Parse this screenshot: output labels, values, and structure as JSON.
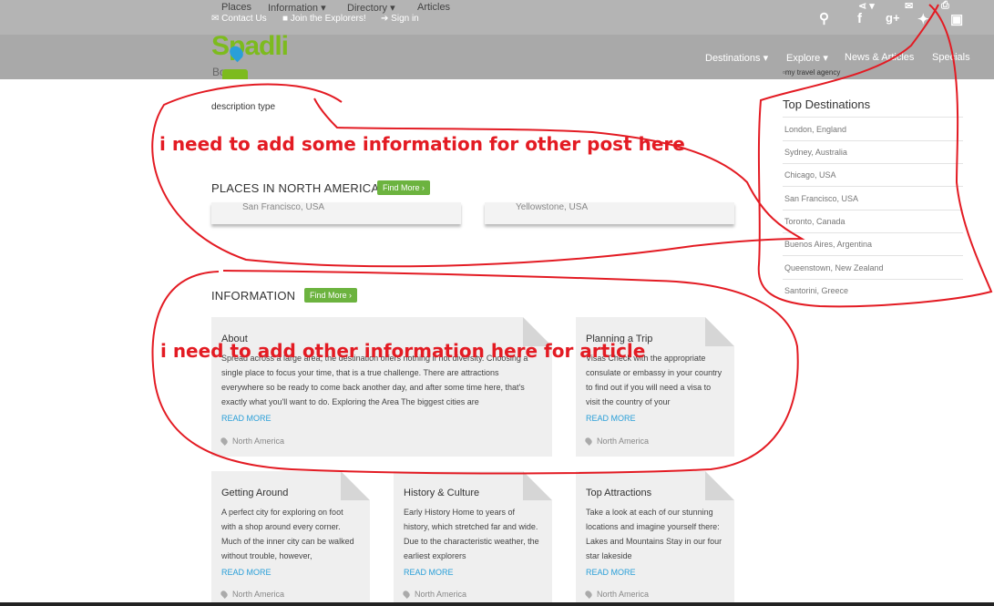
{
  "header": {
    "top_menu": [
      "Places",
      "Information",
      "Directory",
      "Articles"
    ],
    "top_links": [
      "Contact Us",
      "Join the Explorers!",
      "Sign in"
    ],
    "logo_text": "Spadli",
    "logo_sub": "Bo",
    "nav": [
      "Destinations",
      "Explore",
      "News & Articles",
      "Specials"
    ],
    "agency_img_alt": "my travel agency"
  },
  "main": {
    "description": "description type",
    "places_title": "PLACES IN NORTH AMERICA",
    "places_button": "Find More",
    "place_cards": [
      "San Francisco, USA",
      "Yellowstone, USA"
    ],
    "info_title": "INFORMATION",
    "info_button": "Find More",
    "info_cards": [
      {
        "title": "About",
        "text": "Spread across a large area, the destination offers nothing if not diversity. Choosing a single place to focus your time, that is a true challenge. There are attractions everywhere so be ready to come back another day, and after some time here, that's exactly what you'll want to do. Exploring the Area The biggest cities are",
        "read_more": "READ MORE",
        "location": "North America"
      },
      {
        "title": "Planning a Trip",
        "text": "Visas Check with the appropriate consulate or embassy in your country to find out if you will need a visa to visit the country of your",
        "read_more": "READ MORE",
        "location": "North America"
      },
      {
        "title": "Getting Around",
        "text": "A perfect city for exploring on foot with a shop around every corner. Much of the inner city can be walked without trouble, however,",
        "read_more": "READ MORE",
        "location": "North America"
      },
      {
        "title": "History & Culture",
        "text": "Early History Home to years of history, which stretched far and wide. Due to the characteristic weather, the earliest explorers",
        "read_more": "READ MORE",
        "location": "North America"
      },
      {
        "title": "Top Attractions",
        "text": "Take a look at each of our stunning locations and imagine yourself there: Lakes and Mountains Stay in our four star lakeside",
        "read_more": "READ MORE",
        "location": "North America"
      }
    ]
  },
  "sidebar": {
    "title": "Top Destinations",
    "items": [
      "London, England",
      "Sydney, Australia",
      "Chicago, USA",
      "San Francisco, USA",
      "Toronto, Canada",
      "Buenos Aires, Argentina",
      "Queenstown, New Zealand",
      "Santorini, Greece"
    ]
  },
  "annotations": {
    "note1": "i need  to add some information for other post here",
    "note2": "i need to add other information here for article"
  },
  "colors": {
    "accent_green": "#6cb33f",
    "link_blue": "#2a9fd8",
    "annotation_red": "#e31b23",
    "header_gray": "#a9a9a9"
  }
}
